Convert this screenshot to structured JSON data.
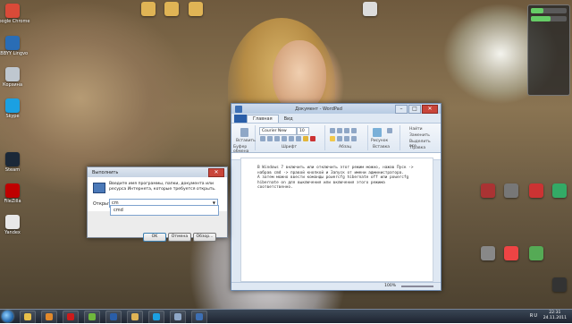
{
  "wordpad": {
    "title": "Документ - WordPad",
    "tabs": [
      "Главная",
      "Вид"
    ],
    "ribbon": {
      "font_name": "Courier New",
      "font_size": "10",
      "groups": [
        "Буфер обмена",
        "Шрифт",
        "Абзац",
        "Вставка",
        "Правка"
      ],
      "insert_label": "Рисунок",
      "edit_find": "Найти",
      "edit_replace": "Заменить",
      "edit_select_all": "Выделить все",
      "paste_label": "Вставить"
    },
    "body_text": "В Windows 7 включить или отключить этот режим можно, нажав Пуск -> набрав cmd -> правой кнопкой и Запуск от имени администратора.\nА затем можно ввести команды powercfg hibernate off или powercfg hibernate on для выключения или включения этого режима соответственно.",
    "zoom": "100%"
  },
  "run_dialog": {
    "title": "Выполнить",
    "description": "Введите имя программы, папки, документа или ресурса Интернета, которые требуется открыть.",
    "open_label": "Открыть:",
    "input_value": "cm",
    "suggestion": "cmd",
    "buttons": {
      "ok": "OK",
      "cancel": "Отмена",
      "browse": "Обзор..."
    }
  },
  "desktop": {
    "icons_left": [
      {
        "label": "Google Chrome",
        "color": "#d94a38"
      },
      {
        "label": "ABBYY Lingvo",
        "color": "#2a6db5"
      },
      {
        "label": "Корзина",
        "color": "#bfc7cf"
      },
      {
        "label": "Skype",
        "color": "#1ba0e2"
      },
      {
        "label": "Steam",
        "color": "#1b2838"
      },
      {
        "label": "FileZilla",
        "color": "#bf0000"
      },
      {
        "label": "Yandex",
        "color": "#e8e8e8"
      }
    ],
    "icons_top": [
      {
        "label": "",
        "color": "#e0b455"
      },
      {
        "label": "",
        "color": "#e0b455"
      },
      {
        "label": "",
        "color": "#e0b455"
      },
      {
        "label": "",
        "color": "#dcdcdc"
      }
    ],
    "icons_right": [
      {
        "label": "",
        "color": "#a33"
      },
      {
        "label": "",
        "color": "#777"
      },
      {
        "label": "",
        "color": "#c33"
      },
      {
        "label": "",
        "color": "#3a6"
      },
      {
        "label": "",
        "color": "#888"
      },
      {
        "label": "",
        "color": "#e44"
      },
      {
        "label": "",
        "color": "#5a5"
      },
      {
        "label": "",
        "color": "#333"
      }
    ]
  },
  "gadget": {
    "cpu_level": 0.35,
    "ram_level": 0.55,
    "text": ""
  },
  "taskbar": {
    "apps": [
      {
        "name": "explorer",
        "color": "#e8c04a"
      },
      {
        "name": "media",
        "color": "#e2892b"
      },
      {
        "name": "opera",
        "color": "#cc1b1b"
      },
      {
        "name": "utorrent",
        "color": "#6fb73c"
      },
      {
        "name": "word",
        "color": "#2a5ea8"
      },
      {
        "name": "folder",
        "color": "#e0b455"
      },
      {
        "name": "skype",
        "color": "#1ba0e2"
      },
      {
        "name": "run",
        "color": "#8fa7c6"
      },
      {
        "name": "wordpad",
        "color": "#3d6fb3"
      }
    ],
    "time": "22:31",
    "date": "24.11.2011",
    "tray_text": "RU"
  }
}
